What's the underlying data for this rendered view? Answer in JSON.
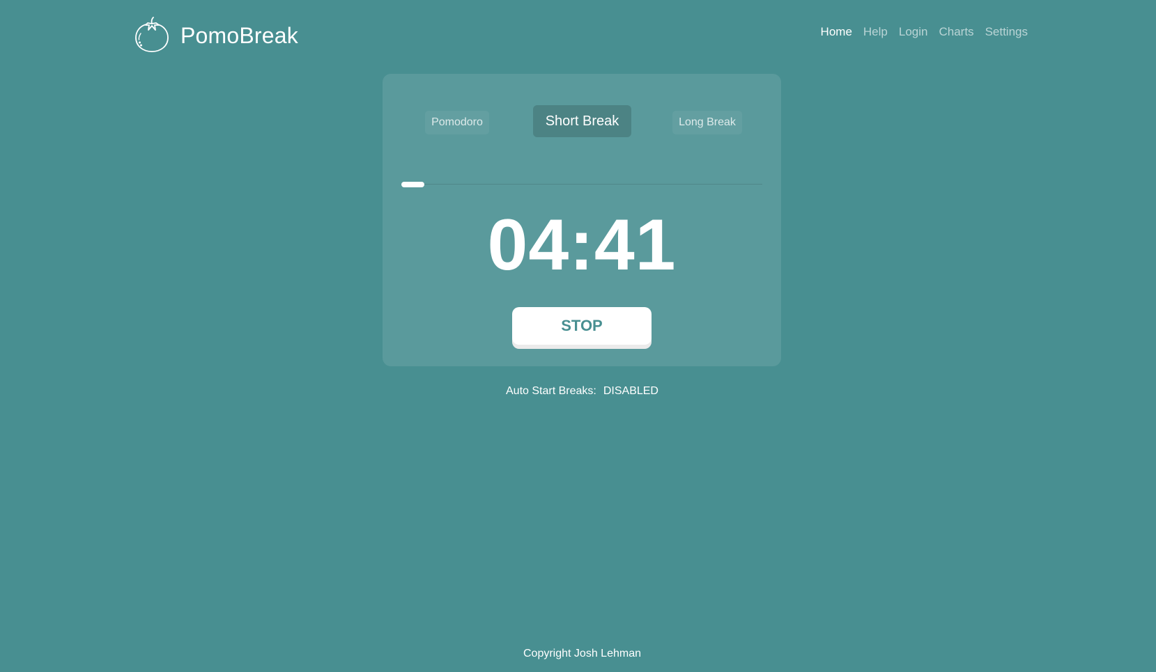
{
  "brand": {
    "name": "PomoBreak"
  },
  "nav": {
    "items": [
      {
        "label": "Home",
        "active": true
      },
      {
        "label": "Help",
        "active": false
      },
      {
        "label": "Login",
        "active": false
      },
      {
        "label": "Charts",
        "active": false
      },
      {
        "label": "Settings",
        "active": false
      }
    ]
  },
  "modes": {
    "pomodoro": "Pomodoro",
    "short_break": "Short Break",
    "long_break": "Long Break",
    "selected": "Short Break"
  },
  "timer": {
    "display": "04:41",
    "progress_fraction": 0.063
  },
  "controls": {
    "stop_label": "STOP"
  },
  "auto_start": {
    "label": "Auto Start Breaks:",
    "value": "DISABLED"
  },
  "footer": {
    "copyright": "Copyright Josh Lehman"
  },
  "colors": {
    "background": "#488f91",
    "text": "#ffffff"
  }
}
